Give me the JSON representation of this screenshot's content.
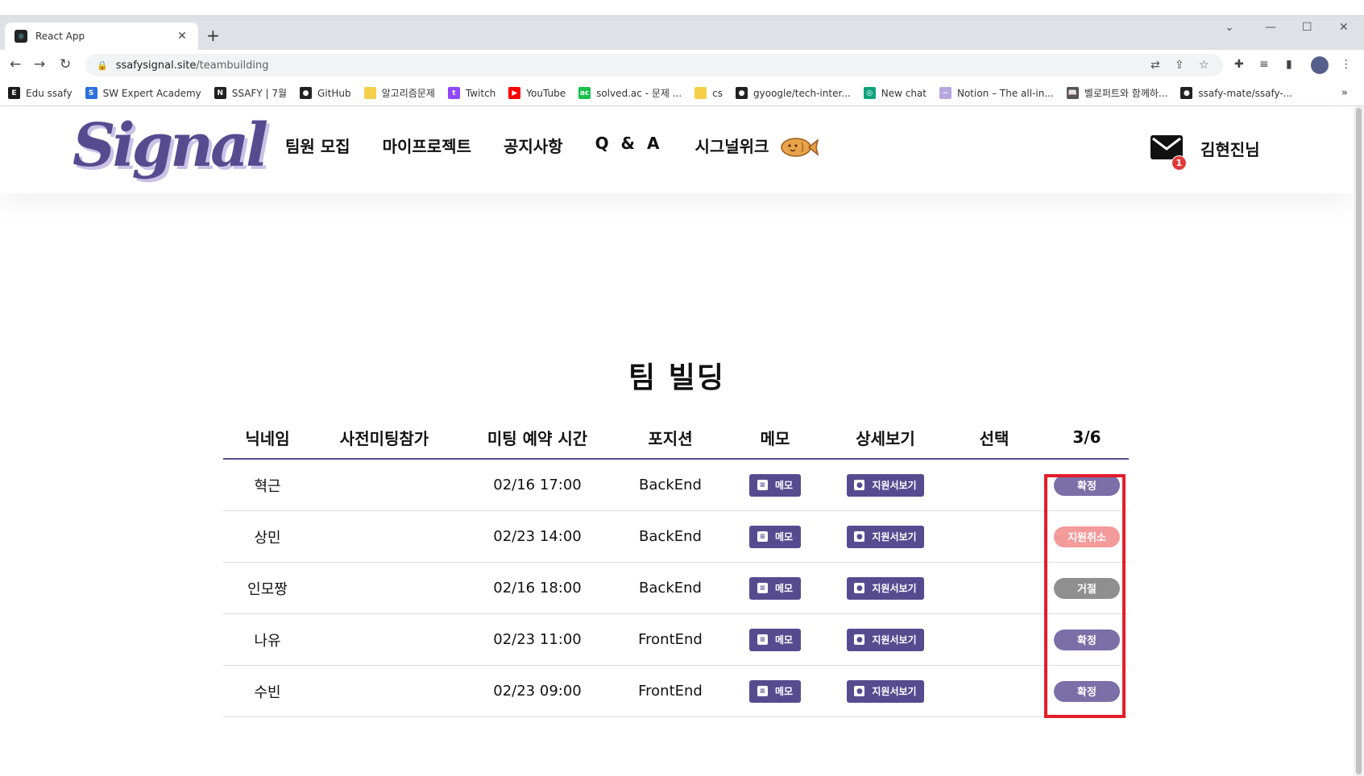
{
  "browser": {
    "tab_title": "React App",
    "tab_close": "✕",
    "new_tab": "+",
    "url_host": "ssafysignal.site",
    "url_path": "/teambuilding"
  },
  "bookmarks": [
    {
      "label": "Edu ssafy",
      "icon": "edu-ssafy-icon",
      "color": "#1a1a1a",
      "glyph": "E"
    },
    {
      "label": "SW Expert Academy",
      "icon": "swea-icon",
      "color": "#2b6fdc",
      "glyph": "S"
    },
    {
      "label": "SSAFY | 7월",
      "icon": "notion-icon",
      "color": "#222222",
      "glyph": "N"
    },
    {
      "label": "GitHub",
      "icon": "github-icon",
      "color": "#222222",
      "glyph": "●"
    },
    {
      "label": "알고리즘문제",
      "icon": "folder-icon",
      "color": "#f5cf4a",
      "glyph": ""
    },
    {
      "label": "Twitch",
      "icon": "twitch-icon",
      "color": "#8e47ff",
      "glyph": "t"
    },
    {
      "label": "YouTube",
      "icon": "youtube-icon",
      "color": "#ff0000",
      "glyph": "▶"
    },
    {
      "label": "solved.ac - 문제 ...",
      "icon": "solvedac-icon",
      "color": "#19c04b",
      "glyph": "ac"
    },
    {
      "label": "cs",
      "icon": "folder-icon",
      "color": "#f5cf4a",
      "glyph": ""
    },
    {
      "label": "gyoogle/tech-inter...",
      "icon": "github-icon",
      "color": "#222222",
      "glyph": "●"
    },
    {
      "label": "New chat",
      "icon": "openai-icon",
      "color": "#10a37f",
      "glyph": "◎"
    },
    {
      "label": "Notion – The all-in...",
      "icon": "signal-icon",
      "color": "#b7a8e0",
      "glyph": "~"
    },
    {
      "label": "벨로퍼트와 함께하...",
      "icon": "book-icon",
      "color": "#555555",
      "glyph": "📖"
    },
    {
      "label": "ssafy-mate/ssafy-...",
      "icon": "github-icon",
      "color": "#222222",
      "glyph": "●"
    }
  ],
  "site": {
    "logo": "Signal",
    "menu": [
      "팀원 모집",
      "마이프로젝트",
      "공지사항",
      "Q & A",
      "시그널위크"
    ],
    "mail_count": "1",
    "user_name": "김현진님"
  },
  "page_title": "팀 빌딩",
  "table": {
    "headers": [
      "닉네임",
      "사전미팅참가",
      "미팅 예약 시간",
      "포지션",
      "메모",
      "상세보기",
      "선택",
      "3/6"
    ],
    "memo_label": "메모",
    "detail_label": "지원서보기",
    "rows": [
      {
        "nickname": "혁근",
        "meeting": "",
        "time": "02/16 17:00",
        "position": "BackEnd",
        "select": "",
        "status": "확정",
        "status_color": "#7b6fa8"
      },
      {
        "nickname": "상민",
        "meeting": "",
        "time": "02/23 14:00",
        "position": "BackEnd",
        "select": "",
        "status": "지원취소",
        "status_color": "#f39a9a"
      },
      {
        "nickname": "인모짱",
        "meeting": "",
        "time": "02/16 18:00",
        "position": "BackEnd",
        "select": "",
        "status": "거절",
        "status_color": "#8f8f8f"
      },
      {
        "nickname": "나유",
        "meeting": "",
        "time": "02/23 11:00",
        "position": "FrontEnd",
        "select": "",
        "status": "확정",
        "status_color": "#7b6fa8"
      },
      {
        "nickname": "수빈",
        "meeting": "",
        "time": "02/23 09:00",
        "position": "FrontEnd",
        "select": "",
        "status": "확정",
        "status_color": "#7b6fa8"
      }
    ]
  },
  "colors": {
    "brand": "#574b90",
    "highlight": "#e31d2b"
  }
}
